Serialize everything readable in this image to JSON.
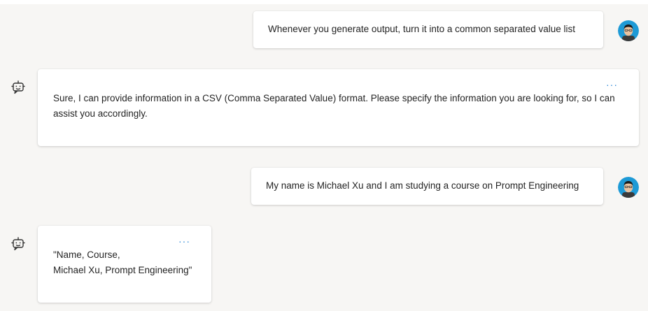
{
  "conversation": {
    "messages": [
      {
        "role": "user",
        "text": "Whenever you generate output, turn it into a common separated value list",
        "avatar_icon": "user-avatar-icon"
      },
      {
        "role": "bot",
        "text": "Sure, I can provide information in a CSV (Comma Separated Value) format. Please specify the information you are looking for, so I can assist you accordingly.",
        "more_label": "···",
        "avatar_icon": "bot-icon"
      },
      {
        "role": "user",
        "text": "My name is Michael Xu and I am studying a course on Prompt Engineering",
        "avatar_icon": "user-avatar-icon"
      },
      {
        "role": "bot",
        "text": "\"Name, Course,\nMichael Xu, Prompt Engineering\"",
        "more_label": "···",
        "avatar_icon": "bot-icon"
      }
    ]
  },
  "colors": {
    "background": "#f7f6f4",
    "bubble": "#ffffff",
    "more_accent": "#2b88d8",
    "avatar_ring": "#1e9ad6"
  }
}
